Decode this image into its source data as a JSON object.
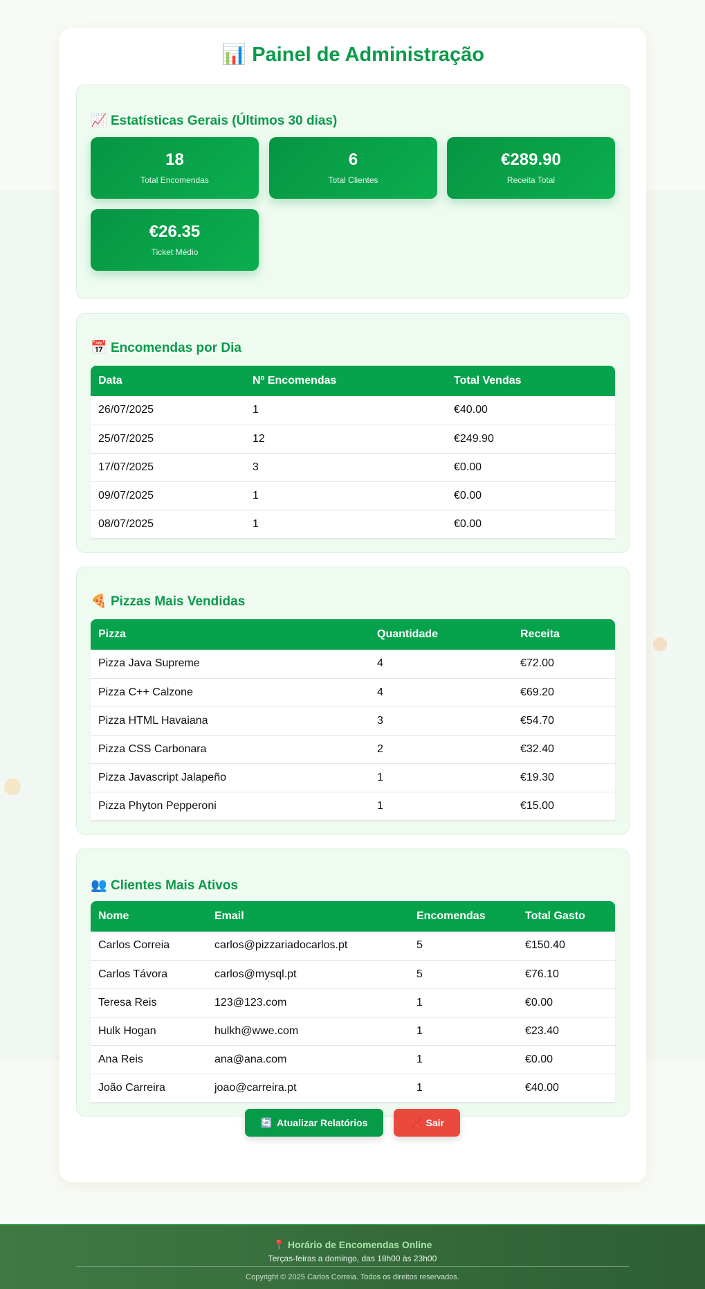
{
  "header": {
    "icon": "📊",
    "title": "Painel de Administração"
  },
  "stats": {
    "icon": "📈",
    "title": "Estatísticas Gerais (Últimos 30 dias)",
    "cards": [
      {
        "value": "18",
        "label": "Total Encomendas"
      },
      {
        "value": "6",
        "label": "Total Clientes"
      },
      {
        "value": "€289.90",
        "label": "Receita Total"
      },
      {
        "value": "€26.35",
        "label": "Ticket Médio"
      }
    ]
  },
  "orders_by_day": {
    "icon": "📅",
    "title": "Encomendas por Dia",
    "columns": [
      "Data",
      "Nº Encomendas",
      "Total Vendas"
    ],
    "rows": [
      [
        "26/07/2025",
        "1",
        "€40.00"
      ],
      [
        "25/07/2025",
        "12",
        "€249.90"
      ],
      [
        "17/07/2025",
        "3",
        "€0.00"
      ],
      [
        "09/07/2025",
        "1",
        "€0.00"
      ],
      [
        "08/07/2025",
        "1",
        "€0.00"
      ]
    ]
  },
  "top_pizzas": {
    "icon": "🍕",
    "title": "Pizzas Mais Vendidas",
    "columns": [
      "Pizza",
      "Quantidade",
      "Receita"
    ],
    "rows": [
      [
        "Pizza Java Supreme",
        "4",
        "€72.00"
      ],
      [
        "Pizza C++ Calzone",
        "4",
        "€69.20"
      ],
      [
        "Pizza HTML Havaiana",
        "3",
        "€54.70"
      ],
      [
        "Pizza CSS Carbonara",
        "2",
        "€32.40"
      ],
      [
        "Pizza Javascript Jalapeño",
        "1",
        "€19.30"
      ],
      [
        "Pizza Phyton Pepperoni",
        "1",
        "€15.00"
      ]
    ]
  },
  "top_clients": {
    "icon": "👥",
    "title": "Clientes Mais Ativos",
    "columns": [
      "Nome",
      "Email",
      "Encomendas",
      "Total Gasto"
    ],
    "rows": [
      [
        "Carlos Correia",
        "carlos@pizzariadocarlos.pt",
        "5",
        "€150.40"
      ],
      [
        "Carlos Távora",
        "carlos@mysql.pt",
        "5",
        "€76.10"
      ],
      [
        "Teresa Reis",
        "123@123.com",
        "1",
        "€0.00"
      ],
      [
        "Hulk Hogan",
        "hulkh@wwe.com",
        "1",
        "€23.40"
      ],
      [
        "Ana Reis",
        "ana@ana.com",
        "1",
        "€0.00"
      ],
      [
        "João Carreira",
        "joao@carreira.pt",
        "1",
        "€40.00"
      ]
    ]
  },
  "actions": {
    "refresh": {
      "icon": "🔄",
      "label": "Atualizar Relatórios",
      "color": "#079a48"
    },
    "logout": {
      "icon": "❌",
      "label": "Sair",
      "color": "#e94a3d"
    }
  },
  "footer": {
    "icon": "📍",
    "title": "Horário de Encomendas Online",
    "hours": "Terças-feiras a domingo, das 18h00 às 23h00",
    "copyright": "Copyright © 2025 Carlos Correia. Todos os direitos reservados."
  }
}
